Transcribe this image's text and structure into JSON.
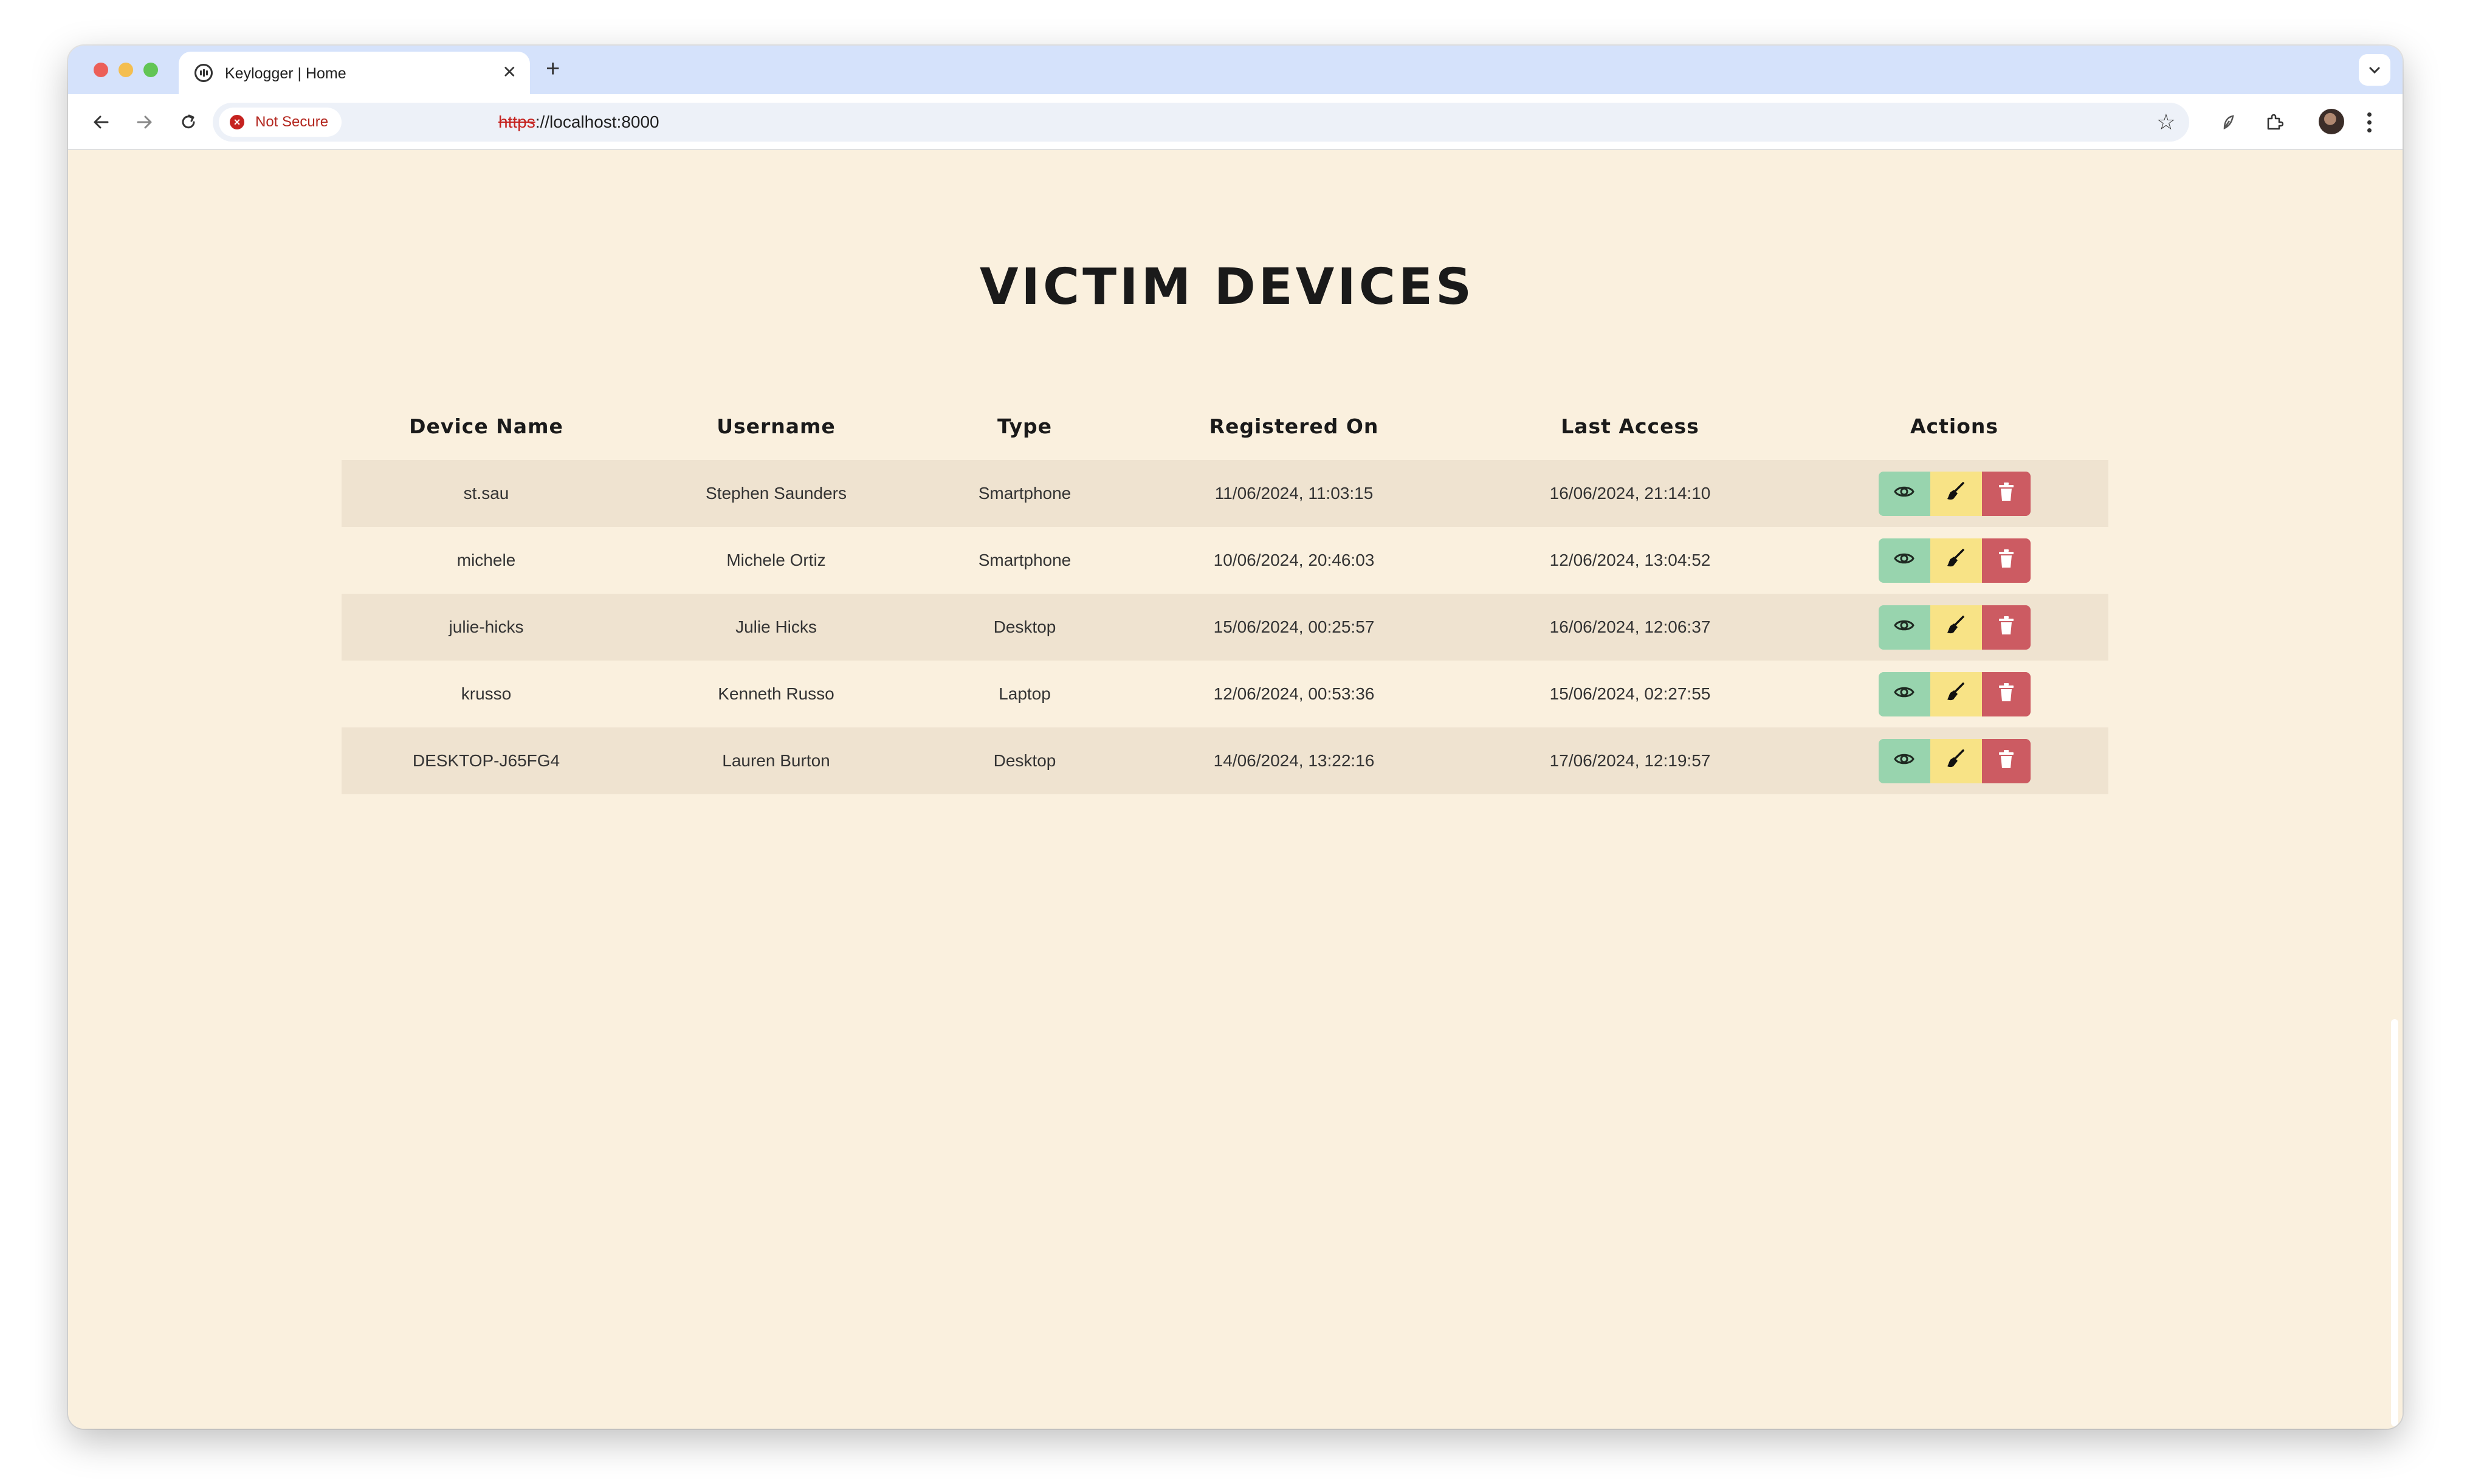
{
  "browser": {
    "tab": {
      "title": "Keylogger | Home"
    },
    "security_label": "Not Secure",
    "url_scheme": "https",
    "url_rest": "://localhost:8000"
  },
  "page": {
    "title": "VICTIM DEVICES",
    "table": {
      "headers": [
        "Device Name",
        "Username",
        "Type",
        "Registered On",
        "Last Access",
        "Actions"
      ],
      "rows": [
        {
          "device_name": "st.sau",
          "username": "Stephen Saunders",
          "type": "Smartphone",
          "registered_on": "11/06/2024, 11:03:15",
          "last_access": "16/06/2024, 21:14:10"
        },
        {
          "device_name": "michele",
          "username": "Michele Ortiz",
          "type": "Smartphone",
          "registered_on": "10/06/2024, 20:46:03",
          "last_access": "12/06/2024, 13:04:52"
        },
        {
          "device_name": "julie-hicks",
          "username": "Julie Hicks",
          "type": "Desktop",
          "registered_on": "15/06/2024, 00:25:57",
          "last_access": "16/06/2024, 12:06:37"
        },
        {
          "device_name": "krusso",
          "username": "Kenneth Russo",
          "type": "Laptop",
          "registered_on": "12/06/2024, 00:53:36",
          "last_access": "15/06/2024, 02:27:55"
        },
        {
          "device_name": "DESKTOP-J65FG4",
          "username": "Lauren Burton",
          "type": "Desktop",
          "registered_on": "14/06/2024, 13:22:16",
          "last_access": "17/06/2024, 12:19:57"
        }
      ],
      "action_icons": [
        "eye-icon",
        "broom-icon",
        "trash-icon"
      ]
    }
  },
  "colors": {
    "page_background": "#faf0de",
    "row_stripe": "#efe3d0",
    "view_button": "#98d4ae",
    "clean_button": "#f8e386",
    "delete_button": "#cc5b62"
  }
}
